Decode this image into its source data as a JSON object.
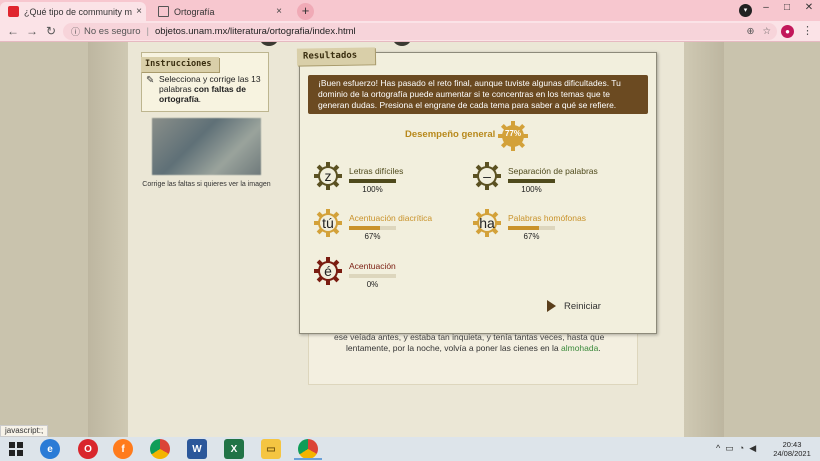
{
  "browser": {
    "tabs": [
      {
        "title": "¿Qué tipo de community manag",
        "active": true
      },
      {
        "title": "Ortografía",
        "active": false
      }
    ],
    "security_label": "No es seguro",
    "url": "objetos.unam.mx/literatura/ortografia/index.html",
    "account_initial": "●"
  },
  "instructions": {
    "tab_label": "Instrucciones",
    "text_prefix": "Selecciona y corrige las 13 palabras ",
    "text_bold": "con faltas de ortografía",
    "text_suffix": ".",
    "image_caption": "Corrige las faltas si quieres ver la imagen"
  },
  "story": {
    "line1": "ese veíada antes, y estaba tan inquieta, y tenía tantas veces, hasta que",
    "line2_prefix": "lentamente, por la noche, volvía a poner las cienes en la ",
    "line2_highlight": "almohada",
    "line2_suffix": "."
  },
  "results": {
    "tab_label": "Resultados",
    "message": "¡Buen esfuerzo! Has pasado el reto final, aunque tuviste algunas dificultades. Tu dominio de la ortografía puede aumentar si te concentras en los temas que te generan dudas. Presiona el engrane de cada tema para saber a qué se refiere.",
    "overall_label": "Desempeño general",
    "overall_value": "77%",
    "overall_fraction": 0.77,
    "categories": [
      {
        "glyph": "z",
        "name": "Letras difíciles",
        "pct": "100%",
        "fraction": 1.0,
        "color": "#4f4a1c",
        "gear": "#5b5122"
      },
      {
        "glyph": "–",
        "name": "Separación de palabras",
        "pct": "100%",
        "fraction": 1.0,
        "color": "#4f4a1c",
        "gear": "#5b5122"
      },
      {
        "glyph": "tú",
        "name": "Acentuación diacrítica",
        "pct": "67%",
        "fraction": 0.67,
        "color": "#c9922a",
        "gear": "#d3a139"
      },
      {
        "glyph": "ha",
        "name": "Palabras homófonas",
        "pct": "67%",
        "fraction": 0.67,
        "color": "#c9922a",
        "gear": "#d3a139"
      },
      {
        "glyph": "é",
        "name": "Acentuación",
        "pct": "0%",
        "fraction": 0.0,
        "color": "#7a1c10",
        "gear": "#7a1c10"
      }
    ],
    "restart_label": "Reiniciar"
  },
  "status_bar": "javascript:;",
  "taskbar": {
    "time": "20:43",
    "date": "24/08/2021"
  },
  "colors": {
    "gold": "#b8891c",
    "brown": "#6b4a21",
    "olive": "#4f4a1c",
    "dark_red": "#7a1c10"
  }
}
